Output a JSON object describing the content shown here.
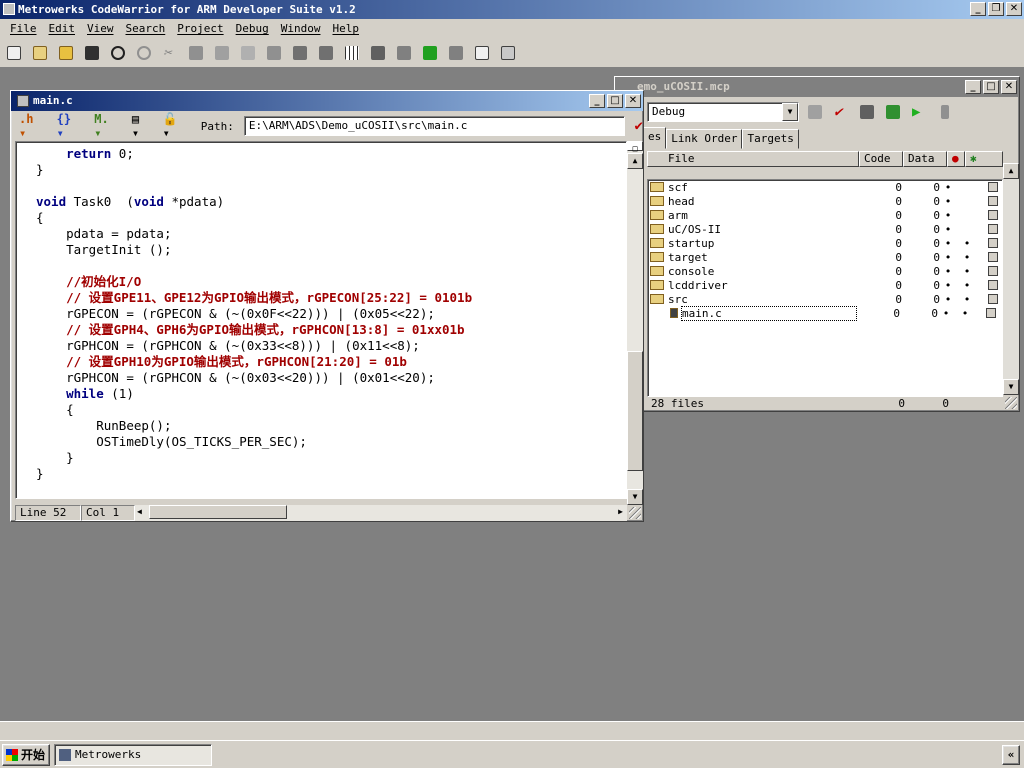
{
  "app": {
    "title": "Metrowerks CodeWarrior for ARM Developer Suite v1.2",
    "menus": [
      "File",
      "Edit",
      "View",
      "Search",
      "Project",
      "Debug",
      "Window",
      "Help"
    ]
  },
  "editor": {
    "title": "main.c",
    "path_label": "Path:",
    "path_value": "E:\\ARM\\ADS\\Demo_uCOSII\\src\\main.c",
    "status_line": "Line 52",
    "status_col": "Col 1",
    "code_lines": [
      {
        "indent": "    ",
        "tokens": [
          {
            "t": "return",
            "k": "kw"
          },
          {
            "t": " 0;",
            "k": ""
          }
        ]
      },
      {
        "indent": "",
        "tokens": [
          {
            "t": "}",
            "k": ""
          }
        ]
      },
      {
        "indent": "",
        "tokens": []
      },
      {
        "indent": "",
        "tokens": [
          {
            "t": "void",
            "k": "kw"
          },
          {
            "t": " Task0  (",
            "k": ""
          },
          {
            "t": "void",
            "k": "kw"
          },
          {
            "t": " *pdata)",
            "k": ""
          }
        ]
      },
      {
        "indent": "",
        "tokens": [
          {
            "t": "{",
            "k": ""
          }
        ]
      },
      {
        "indent": "    ",
        "tokens": [
          {
            "t": "pdata = pdata;",
            "k": ""
          }
        ]
      },
      {
        "indent": "    ",
        "tokens": [
          {
            "t": "TargetInit ();",
            "k": ""
          }
        ]
      },
      {
        "indent": "",
        "tokens": []
      },
      {
        "indent": "    ",
        "tokens": [
          {
            "t": "//初始化I/O",
            "k": "cm"
          }
        ]
      },
      {
        "indent": "    ",
        "tokens": [
          {
            "t": "// 设置GPE11、GPE12为GPIO输出模式，rGPECON[25:22] = 0101b",
            "k": "cm"
          }
        ]
      },
      {
        "indent": "    ",
        "tokens": [
          {
            "t": "rGPECON = (rGPECON & (~(0x0F<<22))) | (0x05<<22);",
            "k": ""
          }
        ]
      },
      {
        "indent": "    ",
        "tokens": [
          {
            "t": "// 设置GPH4、GPH6为GPIO输出模式，rGPHCON[13:8] = 01xx01b",
            "k": "cm"
          }
        ]
      },
      {
        "indent": "    ",
        "tokens": [
          {
            "t": "rGPHCON = (rGPHCON & (~(0x33<<8))) | (0x11<<8);",
            "k": ""
          }
        ]
      },
      {
        "indent": "    ",
        "tokens": [
          {
            "t": "// 设置GPH10为GPIO输出模式，rGPHCON[21:20] = 01b",
            "k": "cm"
          }
        ]
      },
      {
        "indent": "    ",
        "tokens": [
          {
            "t": "rGPHCON = (rGPHCON & (~(0x03<<20))) | (0x01<<20);",
            "k": ""
          }
        ]
      },
      {
        "indent": "    ",
        "tokens": [
          {
            "t": "while",
            "k": "kw"
          },
          {
            "t": " (1)",
            "k": ""
          }
        ]
      },
      {
        "indent": "    ",
        "tokens": [
          {
            "t": "{",
            "k": ""
          }
        ]
      },
      {
        "indent": "        ",
        "tokens": [
          {
            "t": "RunBeep();",
            "k": ""
          }
        ]
      },
      {
        "indent": "        ",
        "tokens": [
          {
            "t": "OSTimeDly(OS_TICKS_PER_SEC);",
            "k": ""
          }
        ]
      },
      {
        "indent": "    ",
        "tokens": [
          {
            "t": "}",
            "k": ""
          }
        ]
      },
      {
        "indent": "",
        "tokens": [
          {
            "t": "}",
            "k": ""
          }
        ]
      }
    ]
  },
  "project": {
    "title": "emo_uCOSII.mcp",
    "target": "Debug",
    "tabs": [
      "es",
      "Link Order",
      "Targets"
    ],
    "columns": [
      "File",
      "Code",
      "Data"
    ],
    "files": [
      {
        "name": "scf",
        "code": "0",
        "data": "0",
        "d1": "•",
        "d2": ""
      },
      {
        "name": "head",
        "code": "0",
        "data": "0",
        "d1": "•",
        "d2": ""
      },
      {
        "name": "arm",
        "code": "0",
        "data": "0",
        "d1": "•",
        "d2": ""
      },
      {
        "name": "uC/OS-II",
        "code": "0",
        "data": "0",
        "d1": "•",
        "d2": ""
      },
      {
        "name": "startup",
        "code": "0",
        "data": "0",
        "d1": "•",
        "d2": "•"
      },
      {
        "name": "target",
        "code": "0",
        "data": "0",
        "d1": "•",
        "d2": "•"
      },
      {
        "name": "console",
        "code": "0",
        "data": "0",
        "d1": "•",
        "d2": "•"
      },
      {
        "name": "lcddriver",
        "code": "0",
        "data": "0",
        "d1": "•",
        "d2": "•"
      },
      {
        "name": "src",
        "code": "0",
        "data": "0",
        "d1": "•",
        "d2": "•"
      },
      {
        "name": "main.c",
        "code": "0",
        "data": "0",
        "d1": "•",
        "d2": "•"
      }
    ],
    "footer_count": "28 files",
    "footer_code": "0",
    "footer_data": "0"
  },
  "taskbar": {
    "start_label": "开始",
    "task_label": "Metrowerks CodeWarr..."
  },
  "colors": {
    "titlebar_active": "#0a246a",
    "keyword": "#00007f",
    "comment": "#a00000"
  }
}
